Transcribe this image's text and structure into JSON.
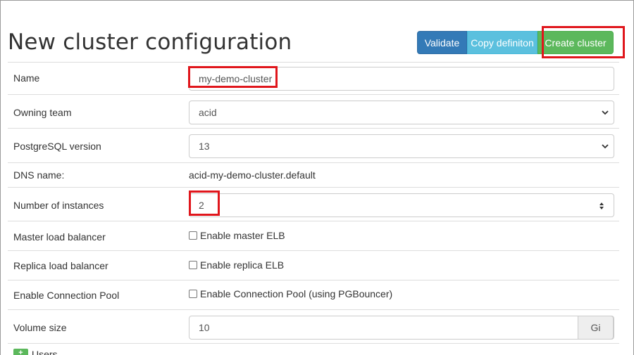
{
  "page": {
    "title": "New cluster configuration"
  },
  "toolbar": {
    "validate_label": "Validate",
    "copy_label": "Copy definiton",
    "create_label": "Create cluster",
    "validate_color": "#337ab7",
    "copy_color": "#5bc0de",
    "create_color": "#5cb85c"
  },
  "form": {
    "name": {
      "label": "Name",
      "value": "my-demo-cluster"
    },
    "owning_team": {
      "label": "Owning team",
      "value": "acid"
    },
    "postgres_version": {
      "label": "PostgreSQL version",
      "value": "13"
    },
    "dns_name": {
      "label": "DNS name:",
      "value": "acid-my-demo-cluster.default"
    },
    "instances": {
      "label": "Number of instances",
      "value": "2"
    },
    "master_lb": {
      "label": "Master load balancer",
      "checkbox_label": "Enable master ELB",
      "checked": false
    },
    "replica_lb": {
      "label": "Replica load balancer",
      "checkbox_label": "Enable replica ELB",
      "checked": false
    },
    "connection_pool": {
      "label": "Enable Connection Pool",
      "checkbox_label": "Enable Connection Pool (using PGBouncer)",
      "checked": false
    },
    "volume_size": {
      "label": "Volume size",
      "value": "10",
      "unit": "Gi"
    }
  },
  "users_section": {
    "icon": "plus-icon",
    "icon_glyph": "+",
    "label": "Users"
  },
  "highlight_color": "#e0161c"
}
